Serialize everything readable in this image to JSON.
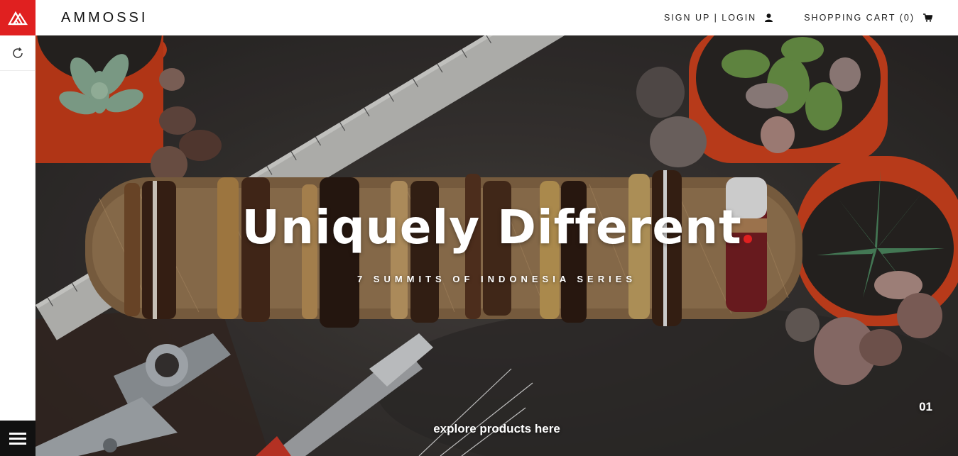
{
  "header": {
    "brand": "AMMOSSI",
    "signup_login": "SIGN UP | LOGIN",
    "cart": "SHOPPING CART (0)"
  },
  "hero": {
    "headline": "Uniquely Different",
    "subline": "7 SUMMITS OF INDONESIA SERIES",
    "cta": "explore products here",
    "slide_number": "01"
  },
  "icons": {
    "logo": "ammossi-logo-icon",
    "refresh": "refresh-icon",
    "menu": "hamburger-menu-icon",
    "user": "user-icon",
    "cart": "shopping-cart-icon"
  },
  "colors": {
    "accent": "#e02020",
    "menu_bg": "#111111"
  }
}
